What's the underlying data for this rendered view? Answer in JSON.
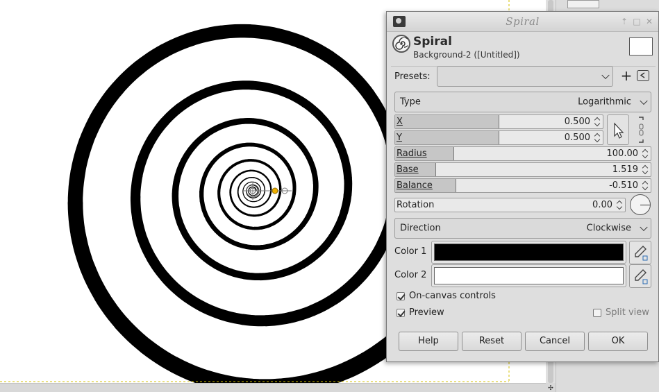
{
  "dialog": {
    "window_title": "Spiral",
    "filter_name": "Spiral",
    "layer_info": "Background-2 ([Untitled])",
    "presets_label": "Presets:",
    "presets_value": "",
    "type": {
      "label": "Type",
      "value": "Logarithmic"
    },
    "x": {
      "label": "X",
      "value": "0.500",
      "fill_fraction": 0.5
    },
    "y": {
      "label": "Y",
      "value": "0.500",
      "fill_fraction": 0.5
    },
    "radius": {
      "label": "Radius",
      "value": "100.00",
      "fill_fraction": 0.23
    },
    "base": {
      "label": "Base",
      "value": "1.519",
      "fill_fraction": 0.16
    },
    "balance": {
      "label": "Balance",
      "value": "-0.510",
      "fill_fraction": 0.24
    },
    "rotation": {
      "label": "Rotation",
      "value": "0.00"
    },
    "direction": {
      "label": "Direction",
      "value": "Clockwise"
    },
    "color1": {
      "label": "Color 1",
      "value": "#000000"
    },
    "color2": {
      "label": "Color 2",
      "value": "#ffffff"
    },
    "on_canvas_controls": {
      "label": "On-canvas controls",
      "checked": true
    },
    "preview": {
      "label": "Preview",
      "checked": true
    },
    "split_view": {
      "label": "Split view",
      "checked": false
    },
    "buttons": {
      "help": "Help",
      "reset": "Reset",
      "cancel": "Cancel",
      "ok": "OK"
    }
  },
  "colors": {
    "dialog_bg": "#dedede",
    "spiral": "#000000",
    "handle": "#f0b000"
  }
}
